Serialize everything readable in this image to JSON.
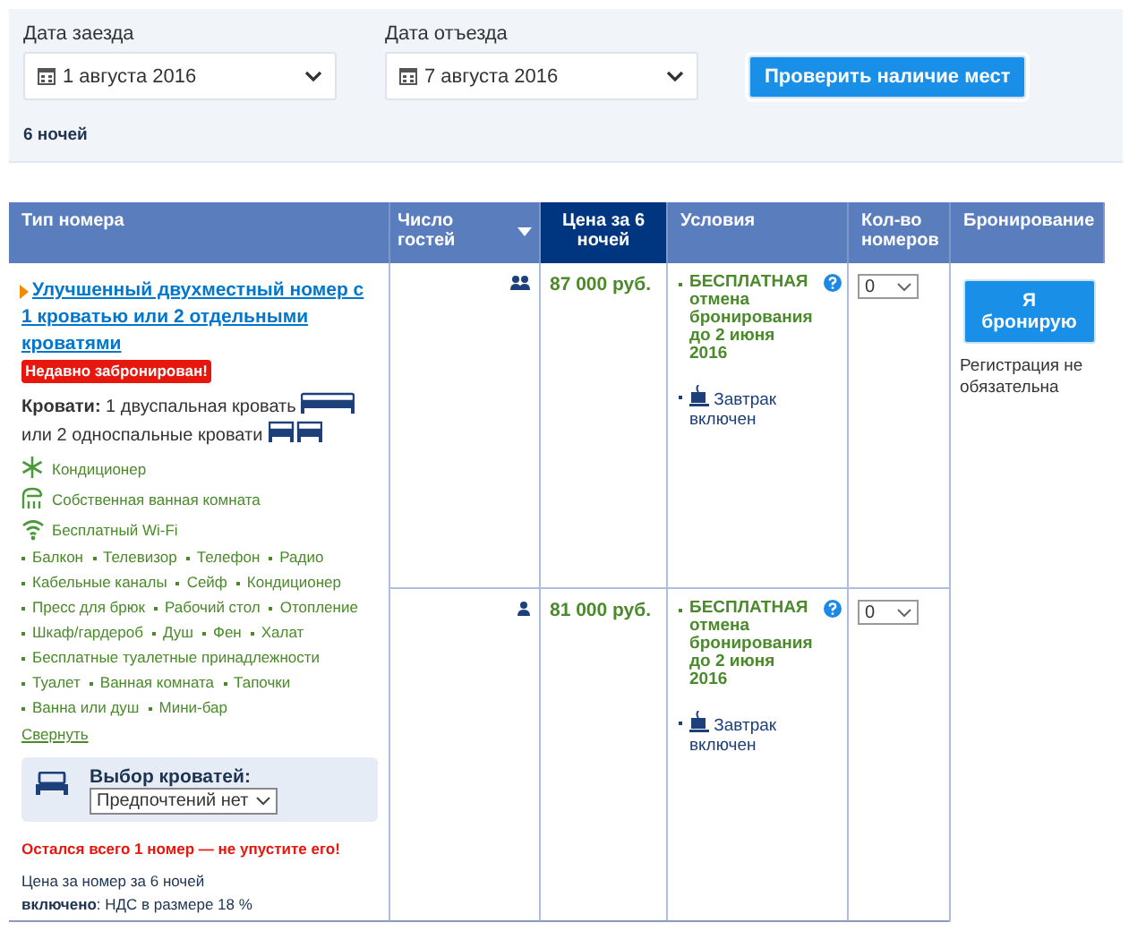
{
  "search": {
    "checkin_label": "Дата заезда",
    "checkin_value": "1 августа 2016",
    "checkout_label": "Дата отъезда",
    "checkout_value": "7 августа 2016",
    "check_button": "Проверить наличие мест",
    "nights": "6 ночей"
  },
  "table": {
    "columns": [
      {
        "label": "Тип номера",
        "selected": false,
        "sorted": false
      },
      {
        "label": "Число гостей",
        "selected": false,
        "sorted": true
      },
      {
        "label": "Цена за 6 ночей",
        "selected": true,
        "sorted": false
      },
      {
        "label": "Условия",
        "selected": false,
        "sorted": false
      },
      {
        "label": "Кол-во номеров",
        "selected": false,
        "sorted": false
      },
      {
        "label": "Бронирование",
        "selected": false,
        "sorted": false
      }
    ],
    "room": {
      "title": "Улучшенный двухместный номер с 1 кроватью или 2 отдельными кроватями",
      "badge": "Недавно забронирован!",
      "beds": [
        {
          "text": "**Кровати:** 1 двуспальная кровать",
          "kind": "double"
        },
        {
          "text": "или 2 односпальные кровати",
          "kind": "twin"
        }
      ],
      "features": [
        {
          "kind": "ac",
          "label": "Кондиционер"
        },
        {
          "kind": "bath",
          "label": "Собственная ванная комната"
        },
        {
          "kind": "wifi",
          "label": "Бесплатный Wi-Fi"
        }
      ],
      "facilities": [
        [
          "Балкон",
          "Телевизор",
          "Телефон",
          "Радио"
        ],
        [
          "Кабельные каналы",
          "Сейф",
          "Кондиционер"
        ],
        [
          "Пресс для брюк",
          "Рабочий стол",
          "Отопление"
        ],
        [
          "Шкаф/гардероб",
          "Душ",
          "Фен",
          "Халат"
        ],
        [
          "Бесплатные туалетные принадлежности"
        ],
        [
          "Туалет",
          "Ванная комната",
          "Тапочки"
        ],
        [
          "Ванна или душ",
          "Мини-бар"
        ]
      ],
      "collapse_link": "Свернуть",
      "bed_choice": {
        "label": "Выбор кроватей:",
        "value": "Предпочтений нет"
      },
      "warning": "Остался всего 1 номер — не упустите его!",
      "price_note": "Цена за номер за 6 ночей",
      "tax_note": "**включено**: НДС в размере 18 %"
    },
    "options": [
      {
        "kind": "double",
        "price": "87 000 руб.",
        "cancellation": "БЕСПЛАТНАЯ отмена бронирования до 2 июня 2016",
        "meal": "Завтрак включен",
        "quantity": "0"
      },
      {
        "kind": "single",
        "price": "81 000 руб.",
        "cancellation": "БЕСПЛАТНАЯ отмена бронирования до 2 июня 2016",
        "meal": "Завтрак включен",
        "quantity": "0"
      }
    ],
    "booking": {
      "button": "Я бронирую",
      "note": "Регистрация не обязательна"
    }
  }
}
